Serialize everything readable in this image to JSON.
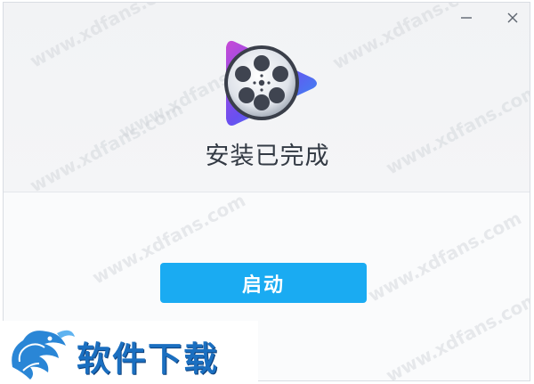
{
  "window": {
    "minimize_label": "minimize",
    "close_label": "close"
  },
  "status": {
    "title": "安装已完成"
  },
  "actions": {
    "launch_label": "启动"
  },
  "overlay": {
    "brand_text": "软件下载",
    "watermark": "www.xdfans.com"
  },
  "colors": {
    "accent": "#1aabf2",
    "brand": "#1b6fc0"
  },
  "icons": {
    "app_logo": "film-reel-play-logo",
    "minimize": "minimize-icon",
    "close": "close-icon",
    "mascot": "dragon-mascot"
  }
}
